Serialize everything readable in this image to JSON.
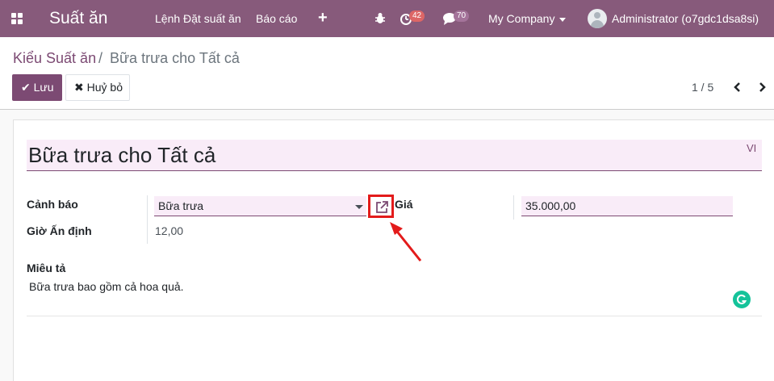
{
  "navbar": {
    "brand": "Suất ăn",
    "menu": [
      "Lệnh Đặt suất ăn",
      "Báo cáo"
    ],
    "activity_count": "42",
    "message_count": "70",
    "company": "My Company",
    "user": "Administrator (o7gdc1dsa8si)",
    "icons": [
      "apps-grid-icon",
      "plus-icon",
      "bug-icon",
      "clock-icon",
      "chat-icon",
      "user-avatar"
    ]
  },
  "breadcrumb": {
    "parent": "Kiểu Suất ăn",
    "separator": "/",
    "current": "Bữa trưa cho Tất cả"
  },
  "toolbar": {
    "save_label": "Lưu",
    "discard_label": "Huỷ bỏ"
  },
  "pager": {
    "value": "1 / 5"
  },
  "form": {
    "name": "Bữa trưa cho Tất cả",
    "lang_code": "VI",
    "alert_label": "Cảnh báo",
    "alert_value": "Bữa trưa",
    "fixed_time_label": "Giờ Ấn định",
    "fixed_time_value": "12,00",
    "price_label": "Giá",
    "price_value": "35.000,00",
    "description_label": "Miêu tả",
    "description_value": "Bữa trưa bao gồm cả hoa quả."
  },
  "colors": {
    "navbar": "#875a7b",
    "primary": "#7c4a73",
    "field_bg": "#f9ecf8",
    "highlight": "#e31b1b"
  }
}
